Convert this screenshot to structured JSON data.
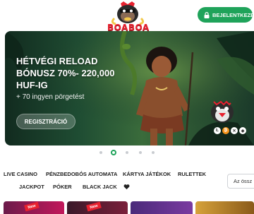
{
  "header": {
    "logo_text": "BOABOA",
    "login_label": "BEJELENTKEZÉS"
  },
  "hero": {
    "title_line1": "HÉTVÉGI RELOAD",
    "title_line2": "BÓNUSZ 70%- 220,000",
    "title_line3": "HUF-IG",
    "subtitle": "+ 70 ingyen pörgetést",
    "button_label": "REGISZTRÁCIÓ",
    "payment_icons": [
      "litecoin-icon",
      "bitcoin-icon",
      "ripple-icon",
      "ethereum-icon"
    ],
    "payment_glyphs": [
      "Ł",
      "₿",
      "✕",
      "◆"
    ]
  },
  "carousel": {
    "slide_count": 5,
    "active_index": 1
  },
  "categories": {
    "row1": [
      "LIVE CASINO",
      "PÉNZBEDOBÓS AUTOMATA",
      "KÁRTYA JÁTÉKOK",
      "RULETTEK"
    ],
    "row2": [
      "JACKPOT",
      "PÓKER",
      "BLACK JACK"
    ],
    "favorites_icon": "heart-icon"
  },
  "filter": {
    "label": "Az össz"
  },
  "tiles": {
    "badge_label": "New"
  },
  "colors": {
    "brand_green": "#1fa35a",
    "brand_red": "#e8212f",
    "hero_dark": "#1f4d33"
  }
}
